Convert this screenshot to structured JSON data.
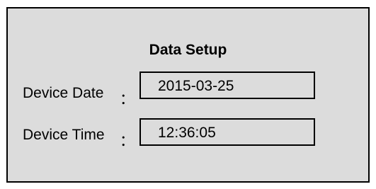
{
  "dialog": {
    "title": "Data Setup",
    "date": {
      "label": "Device Date",
      "separator": "：",
      "value": "2015-03-25"
    },
    "time": {
      "label": "Device Time",
      "separator": "：",
      "value": "12:36:05"
    }
  },
  "colors": {
    "panel_background": "#dcdcdc",
    "border": "#000000",
    "text": "#000000"
  }
}
